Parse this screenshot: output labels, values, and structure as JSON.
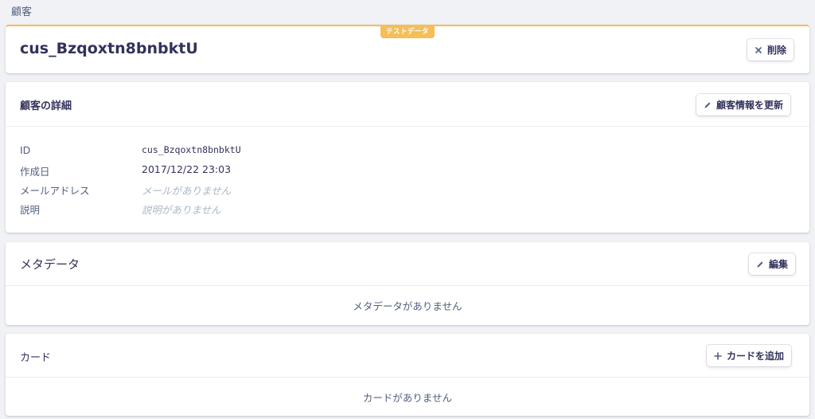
{
  "breadcrumb": {
    "label": "顧客"
  },
  "header": {
    "badge": "テストデータ",
    "customer_id": "cus_Bzqoxtn8bnbktU",
    "delete_label": "削除"
  },
  "details": {
    "title": "顧客の詳細",
    "update_label": "顧客情報を更新",
    "rows": [
      {
        "label": "ID",
        "value": "cus_Bzqoxtn8bnbktU"
      },
      {
        "label": "作成日",
        "value": "2017/12/22 23:03"
      },
      {
        "label": "メールアドレス",
        "value": "メールがありません"
      },
      {
        "label": "説明",
        "value": "説明がありません"
      }
    ]
  },
  "metadata": {
    "title": "メタデータ",
    "edit_label": "編集",
    "empty": "メタデータがありません"
  },
  "cards": {
    "title": "カード",
    "add_label": "カードを追加",
    "empty": "カードがありません"
  },
  "colors": {
    "test_badge": "#f5be58",
    "background": "#f1f2f6"
  },
  "icons": {
    "delete": "close-icon",
    "update": "pencil-icon",
    "edit": "pencil-icon",
    "add": "plus-icon"
  }
}
